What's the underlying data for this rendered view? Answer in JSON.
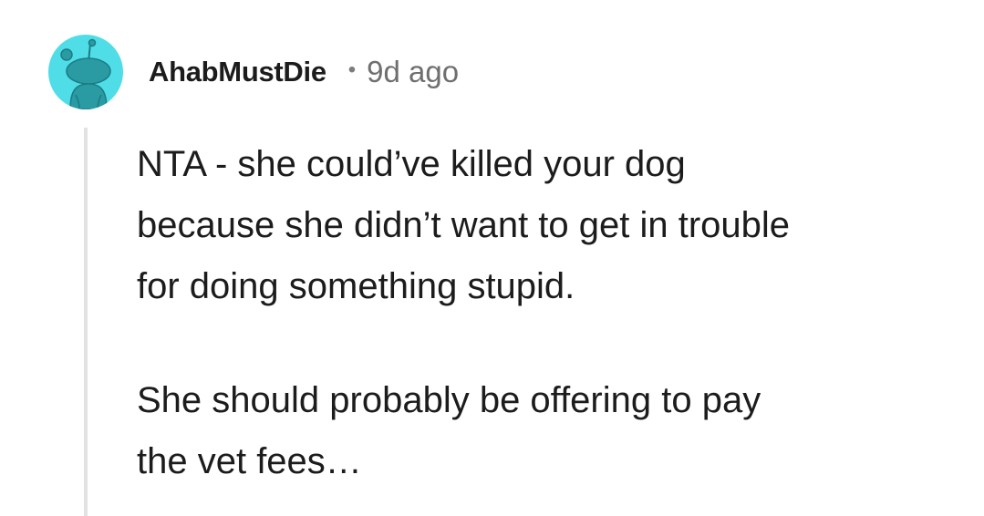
{
  "comment": {
    "author": "AhabMustDie",
    "separator": "•",
    "age": "9d ago",
    "avatar_icon": "reddit-snoo-icon",
    "avatar_color": "#4fdde8",
    "paragraphs": [
      "NTA - she could’ve killed your dog\nbecause she didn’t want to get in trouble\nfor doing something stupid.",
      "She should probably be offering to pay\nthe vet fees…"
    ]
  }
}
